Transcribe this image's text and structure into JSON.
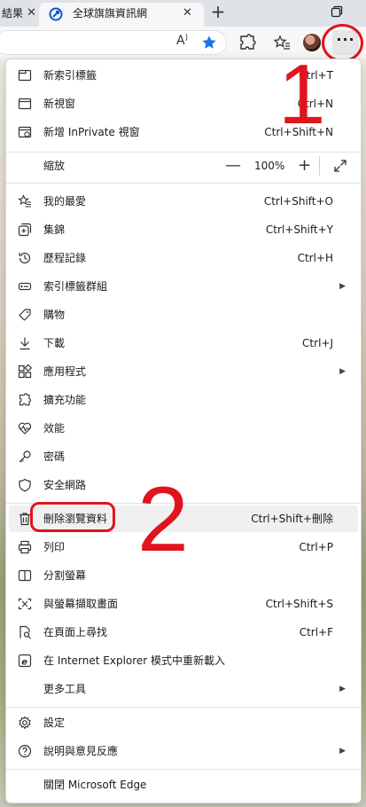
{
  "tabs": {
    "prev_title": "結果",
    "active_title": "全球旗旗資訊網",
    "new_tab": "+"
  },
  "toolbar": {
    "read_aloud_label": "A",
    "more_label": "···"
  },
  "menu": {
    "new_tab": {
      "label": "新索引標籤",
      "shortcut": "Ctrl+T"
    },
    "new_window": {
      "label": "新視窗",
      "shortcut": "Ctrl+N"
    },
    "new_inprivate": {
      "label": "新增 InPrivate 視窗",
      "shortcut": "Ctrl+Shift+N"
    },
    "zoom": {
      "label": "縮放",
      "minus": "—",
      "value": "100%",
      "plus": "+"
    },
    "favorites": {
      "label": "我的最愛",
      "shortcut": "Ctrl+Shift+O"
    },
    "collections": {
      "label": "集錦",
      "shortcut": "Ctrl+Shift+Y"
    },
    "history": {
      "label": "歷程記錄",
      "shortcut": "Ctrl+H"
    },
    "tab_groups": {
      "label": "索引標籤群組"
    },
    "shopping": {
      "label": "購物"
    },
    "downloads": {
      "label": "下載",
      "shortcut": "Ctrl+J"
    },
    "apps": {
      "label": "應用程式"
    },
    "extensions": {
      "label": "擴充功能"
    },
    "performance": {
      "label": "效能"
    },
    "passwords": {
      "label": "密碼"
    },
    "browser_essentials": {
      "label": "安全網路"
    },
    "clear_data": {
      "label": "刪除瀏覽資料",
      "shortcut": "Ctrl+Shift+刪除"
    },
    "print": {
      "label": "列印",
      "shortcut": "Ctrl+P"
    },
    "split_screen": {
      "label": "分割螢幕"
    },
    "screenshot": {
      "label": "與螢幕擷取畫面",
      "shortcut": "Ctrl+Shift+S"
    },
    "find": {
      "label": "在頁面上尋找",
      "shortcut": "Ctrl+F"
    },
    "ie_mode": {
      "label": "在 Internet Explorer 模式中重新載入"
    },
    "more_tools": {
      "label": "更多工具"
    },
    "settings": {
      "label": "設定"
    },
    "help": {
      "label": "說明與意見反應"
    },
    "close_edge": {
      "label": "關閉 Microsoft Edge"
    }
  },
  "annotations": {
    "step1": "1",
    "step2": "2",
    "color": "#e0141e"
  },
  "colors": {
    "accent_star": "#1a73e8",
    "favicon": "#0b57d0"
  }
}
